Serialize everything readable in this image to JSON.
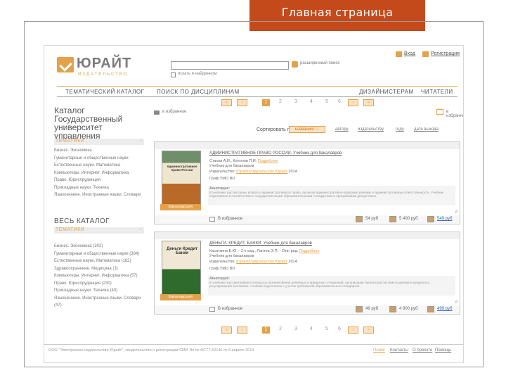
{
  "slide": {
    "title": "Главная страница"
  },
  "header": {
    "logo_name": "ЮРАЙТ",
    "logo_sub": "ИЗДАТЕЛЬСТВО",
    "search_placeholder": "",
    "advanced_search": "расширенный поиск",
    "search_in_results": "искать в найденном",
    "login": "Вход",
    "register": "Регистрация"
  },
  "nav": {
    "items": [
      "ТЕМАТИЧЕСКИЙ КАТАЛОГ",
      "ПОИСК ПО ДИСЦИПЛИНАМ",
      "ДИЗАЙНИСТЕРАМ",
      "ЧИТАТЕЛИ"
    ]
  },
  "pager": {
    "pages": [
      "1",
      "2",
      "3",
      "4",
      "5",
      "6"
    ],
    "current": "1",
    "first": "«",
    "prev": "‹",
    "next": "›",
    "last": "»"
  },
  "left": {
    "catalog_title": "Каталог Государственный университет управления",
    "section1": {
      "label": "ТЕМАТИКИ",
      "title": ""
    },
    "list1": [
      "Бизнес. Экономика",
      "Гуманитарные и общественные науки",
      "Естественные науки. Математика",
      "Компьютеры. Интернет. Информатика",
      "Право. Юриспруденция",
      "Прикладные науки. Техника",
      "Языкознание. Иностранные языки. Словари"
    ],
    "section2": {
      "title": "ВЕСЬ КАТАЛОГ",
      "label": "ТЕМАТИКИ"
    },
    "list2": [
      "Бизнес. Экономика (302)",
      "Гуманитарные и общественные науки (384)",
      "Естественные науки. Математика (162)",
      "Здравоохранение. Медицина (3)",
      "Компьютеры. Интернет. Информатика (57)",
      "Право. Юриспруденция (230)",
      "Прикладные науки. Техника (40)",
      "Языкознание. Иностранные языки. Словари (47)"
    ]
  },
  "main": {
    "cart_label": "в избранное",
    "fav_label": "в избранное",
    "sort_label": "Сортировать по:",
    "sort_active": "названию ↑↓",
    "sort_options": [
      "автору",
      "издательству",
      "году",
      "дате выхода"
    ],
    "cards": [
      {
        "title": "АДМИНИСТРАТИВНОЕ ПРАВО РОССИИ. Учебник для бакалавров",
        "authors": "Стахов А.И., Кононов П.И.",
        "authors_link": "Подробнее",
        "type": "Учебник для бакалавров",
        "publisher_label": "Издательство:",
        "publisher": "Юрайт/Издательство Юрайт",
        "year": "2014",
        "grif": "Гриф УМО ВО",
        "cover_text": "Административное право России",
        "badge": "Бакалавриат",
        "annotation_title": "Аннотация:",
        "annotation": "В учебнике рассмотрены вопросы административного права, включая административно-правовые режимы и административную ответственность. Учебник подготовлен в соответствии с государственными образовательными стандартами и программами дисциплины.",
        "favorite": "В избранное",
        "price1": "54 руб",
        "price2": "5 400 руб",
        "price3": "549 руб"
      },
      {
        "title": "ДЕНЬГИ. КРЕДИТ. БАНКИ. Учебник для бакалавров",
        "authors": "Касаткина Е.Ю. - 2-е изд., Лаптев Э.П. - Отв. ред.",
        "authors_link": "Подробнее",
        "type": "Учебник для бакалавров",
        "publisher_label": "Издательство:",
        "publisher": "Юрайт/Издательство Юрайт",
        "year": "2014",
        "grif": "Гриф УМО ВО",
        "cover_text": "Деньги Кредит Банки",
        "badge": "Бакалавриат",
        "annotation_title": "Аннотация:",
        "annotation": "В учебнике рассматриваются вопросы возникновения денежных и кредитных отношений, организации банковской системы и денежно-кредитного регулирования экономики. Учебник подготовлен с учетом требований образовательных стандартов.",
        "favorite": "В избранное",
        "price1": "49 руб",
        "price2": "4 900 руб",
        "price3": "499 руб"
      }
    ]
  },
  "footer": {
    "copyright": "ООО \"Электронное издательство Юрайт\", свидетельство о регистрации СМИ Эл № ФС77-52146 от 6 апреля 2013",
    "links": [
      "Поиск",
      "Контакты",
      "О проекте",
      "Помощь"
    ]
  },
  "colors": {
    "accent": "#e3a24a",
    "slide_bar": "#c4491b"
  },
  "icons": [
    "login-icon",
    "register-icon",
    "search-icon",
    "cart-icon",
    "favorite-icon",
    "price-icon",
    "expand-icon"
  ]
}
